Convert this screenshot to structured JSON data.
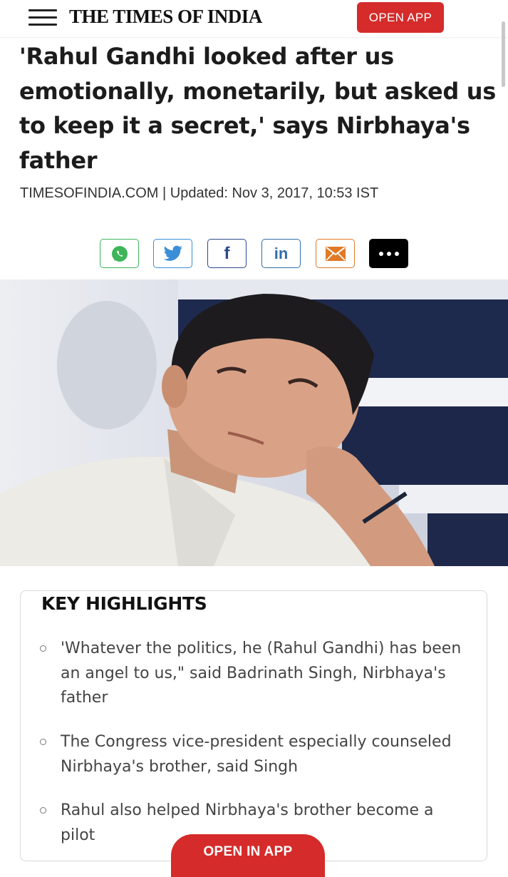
{
  "header": {
    "logo_text": "THE TIMES OF INDIA",
    "open_app_label": "OPEN APP"
  },
  "article": {
    "headline": "'Rahul Gandhi looked after us emotionally, monetarily, but asked us to keep it a secret,' says Nirbhaya's father",
    "byline": "TIMESOFINDIA.COM | Updated: Nov 3, 2017, 10:53 IST"
  },
  "share": {
    "buttons": [
      "whatsapp-icon",
      "twitter-icon",
      "facebook-icon",
      "linkedin-icon",
      "email-icon",
      "more-icon"
    ],
    "facebook_glyph": "f",
    "linkedin_glyph": "in"
  },
  "key_highlights": {
    "title": "KEY HIGHLIGHTS",
    "items": [
      "'Whatever the politics, he (Rahul Gandhi) has been an angel to us,\" said Badrinath Singh, Nirbhaya's father",
      "The Congress vice-president especially counseled Nirbhaya's brother, said Singh",
      "Rahul also helped Nirbhaya's brother become a pilot"
    ]
  },
  "bottom_cta": {
    "label": "OPEN IN APP"
  },
  "colors": {
    "brand_red": "#d52b2b",
    "whatsapp": "#3fb55a",
    "twitter": "#3a8ed8",
    "facebook": "#2c4a8a",
    "linkedin": "#2f6ea8",
    "email": "#e07a27"
  }
}
